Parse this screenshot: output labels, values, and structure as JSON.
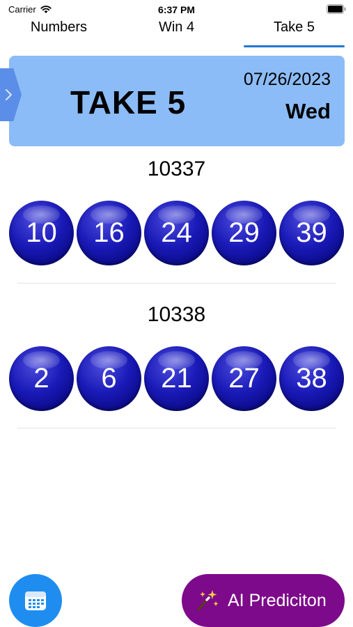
{
  "status_bar": {
    "carrier": "Carrier",
    "time": "6:37 PM"
  },
  "tabs": [
    {
      "label": "Numbers",
      "active": false
    },
    {
      "label": "Win 4",
      "active": false
    },
    {
      "label": "Take 5",
      "active": true
    }
  ],
  "header": {
    "title": "TAKE 5",
    "date": "07/26/2023",
    "day": "Wed"
  },
  "draws": [
    {
      "number": "10337",
      "balls": [
        "10",
        "16",
        "24",
        "29",
        "39"
      ]
    },
    {
      "number": "10338",
      "balls": [
        "2",
        "6",
        "21",
        "27",
        "38"
      ]
    }
  ],
  "buttons": {
    "calendar_icon": "calendar-icon",
    "ai_label": "AI Prediciton",
    "ai_icon": "magic-wand-icon"
  },
  "colors": {
    "accent": "#1f78d1",
    "header_bg": "#8cbcf7",
    "ball": "#1a1ab8",
    "ai_button": "#7d0a8a",
    "calendar_button": "#1f8df0"
  }
}
